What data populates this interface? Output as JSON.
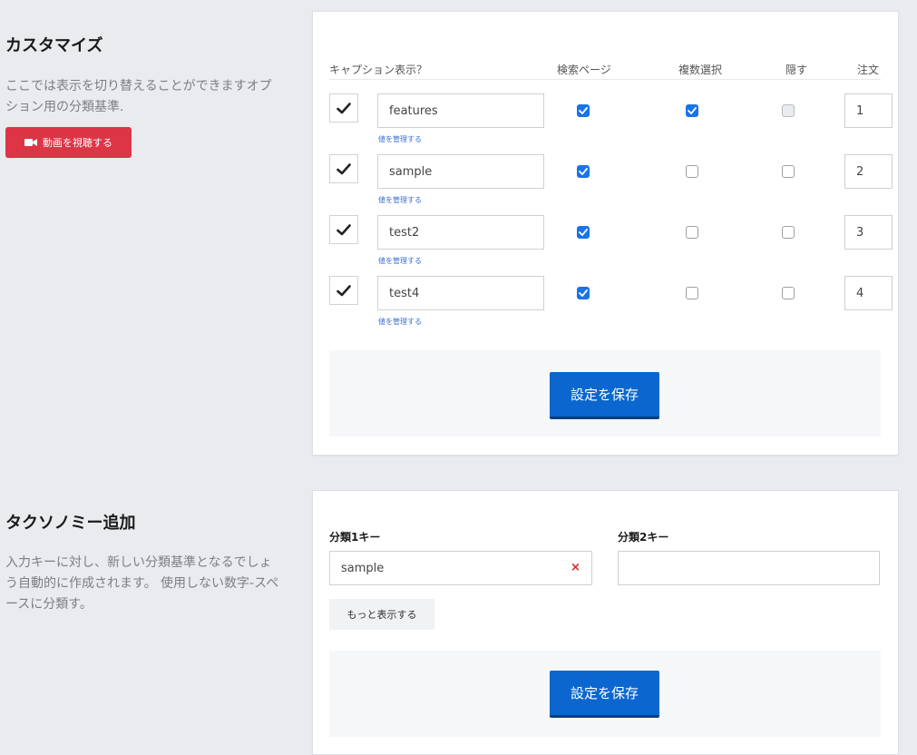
{
  "customize": {
    "title": "カスタマイズ",
    "description": "ここでは表示を切り替えることができますオプション用の分類基準.",
    "video_button_label": "動画を視聴する",
    "headers": {
      "caption": "キャプション表示？",
      "search": "検索ページ",
      "multiple": "複数選択",
      "hide": "隠す",
      "order": "注文"
    },
    "rows": [
      {
        "name": "features",
        "caption": true,
        "search": true,
        "multiple": true,
        "hide": false,
        "hide_disabled": true,
        "order": "1",
        "manage": "値を管理する"
      },
      {
        "name": "sample",
        "caption": true,
        "search": true,
        "multiple": false,
        "hide": false,
        "hide_disabled": false,
        "order": "2",
        "manage": "値を管理する"
      },
      {
        "name": "test2",
        "caption": true,
        "search": true,
        "multiple": false,
        "hide": false,
        "hide_disabled": false,
        "order": "3",
        "manage": "値を管理する"
      },
      {
        "name": "test4",
        "caption": true,
        "search": true,
        "multiple": false,
        "hide": false,
        "hide_disabled": false,
        "order": "4",
        "manage": "値を管理する"
      }
    ],
    "save_label": "設定を保存"
  },
  "taxonomy": {
    "title": "タクソノミー追加",
    "description": "入力キーに対し、新しい分類基準となるでしょう自動的に作成されます。 使用しない数字-スペースに分類す。",
    "key1_label": "分類1キー",
    "key1_value": "sample",
    "key2_label": "分類2キー",
    "key2_value": "",
    "clear_symbol": "×",
    "more_label": "もっと表示する",
    "save_label": "設定を保存"
  },
  "colors": {
    "background": "#e9ebee",
    "primary": "#0b67cf",
    "danger": "#dc3545",
    "checkbox": "#1a73e8"
  }
}
